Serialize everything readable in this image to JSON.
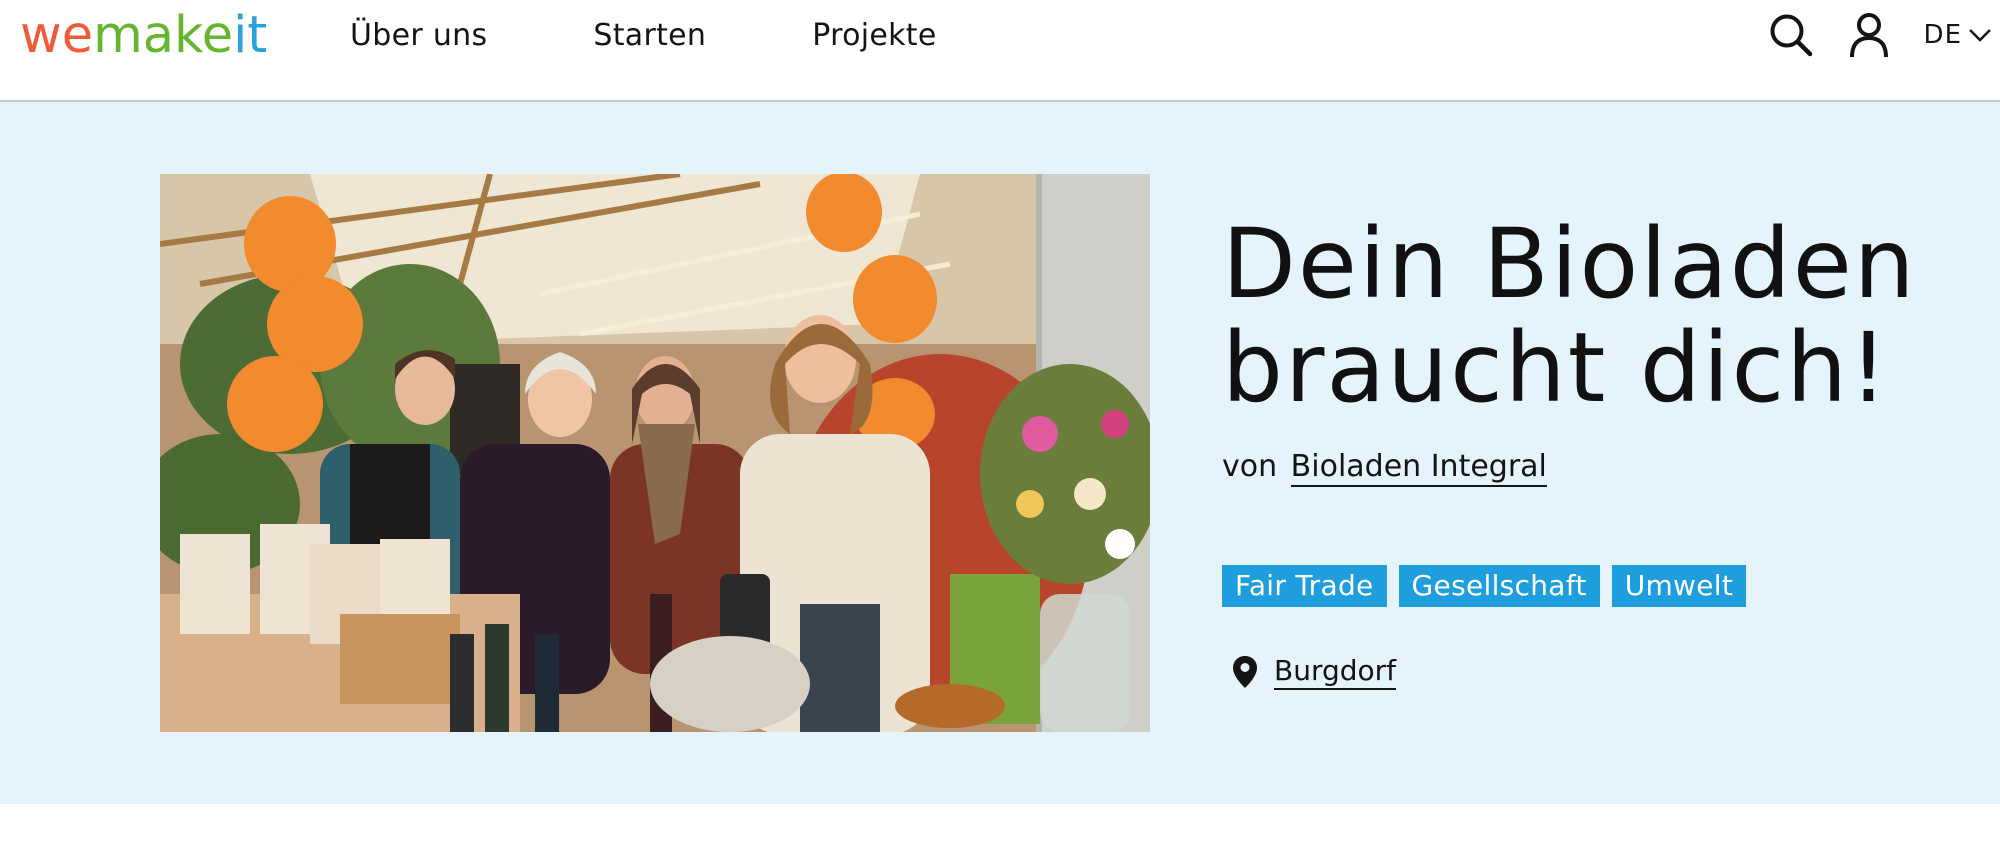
{
  "brand": {
    "logo_we": "we",
    "logo_make": "make",
    "logo_it": "it"
  },
  "nav": {
    "items": [
      {
        "label": "Über uns"
      },
      {
        "label": "Starten"
      },
      {
        "label": "Projekte"
      }
    ]
  },
  "header": {
    "language": "DE",
    "icons": [
      "search-icon",
      "user-icon",
      "chevron-down-icon"
    ]
  },
  "project": {
    "title": "Dein Bioladen braucht dich!",
    "by_prefix": "von",
    "owner": "Bioladen Integral",
    "tags": [
      {
        "label": "Fair Trade"
      },
      {
        "label": "Gesellschaft"
      },
      {
        "label": "Umwelt"
      }
    ],
    "location": "Burgdorf",
    "location_icon": "map-pin-icon",
    "image_description": "photo"
  },
  "colors": {
    "logo_we": "#ee5a3a",
    "logo_make": "#66b52e",
    "logo_it": "#2aa0dc",
    "hero_background": "#e5f4fc",
    "tag_background": "#1f9ede",
    "tag_text": "#ffffff",
    "balloon": "#f28a2e"
  }
}
